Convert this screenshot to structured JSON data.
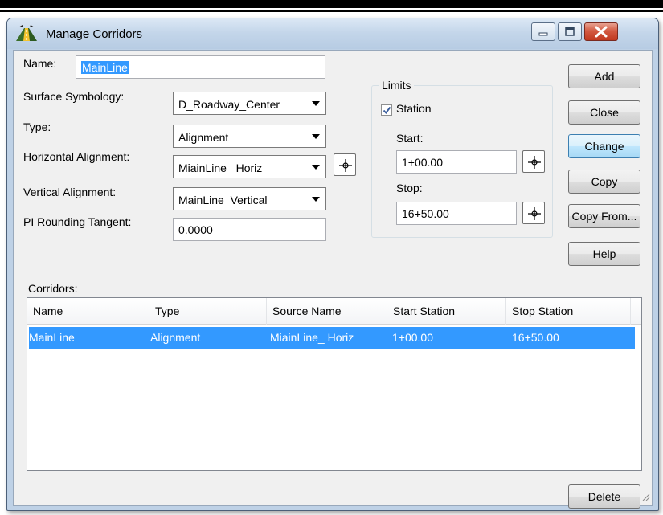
{
  "window": {
    "title": "Manage Corridors"
  },
  "form": {
    "name_label": "Name:",
    "name_value": "MainLine",
    "surface_label": "Surface Symbology:",
    "surface_value": "D_Roadway_Center",
    "type_label": "Type:",
    "type_value": "Alignment",
    "horiz_label": "Horizontal Alignment:",
    "horiz_value": "MiainLine_ Horiz",
    "vert_label": "Vertical Alignment:",
    "vert_value": "MainLine_Vertical",
    "pi_label": "PI Rounding Tangent:",
    "pi_value": "0.0000"
  },
  "limits": {
    "title": "Limits",
    "station_label": "Station",
    "station_checked": true,
    "start_label": "Start:",
    "start_value": "1+00.00",
    "stop_label": "Stop:",
    "stop_value": "16+50.00"
  },
  "buttons": {
    "add": "Add",
    "close": "Close",
    "change": "Change",
    "copy": "Copy",
    "copy_from": "Copy From...",
    "help": "Help",
    "delete": "Delete"
  },
  "corridors": {
    "label": "Corridors:",
    "columns": [
      "Name",
      "Type",
      "Source Name",
      "Start Station",
      "Stop Station"
    ],
    "rows": [
      [
        "MainLine",
        "Alignment",
        "MiainLine_ Horiz",
        "1+00.00",
        "16+50.00"
      ]
    ]
  },
  "icons": [
    "app-icon",
    "minimize-icon",
    "maximize-icon",
    "close-icon",
    "target-pick-icon",
    "checkmark-icon",
    "dropdown-arrow-icon",
    "resize-grip-icon"
  ]
}
